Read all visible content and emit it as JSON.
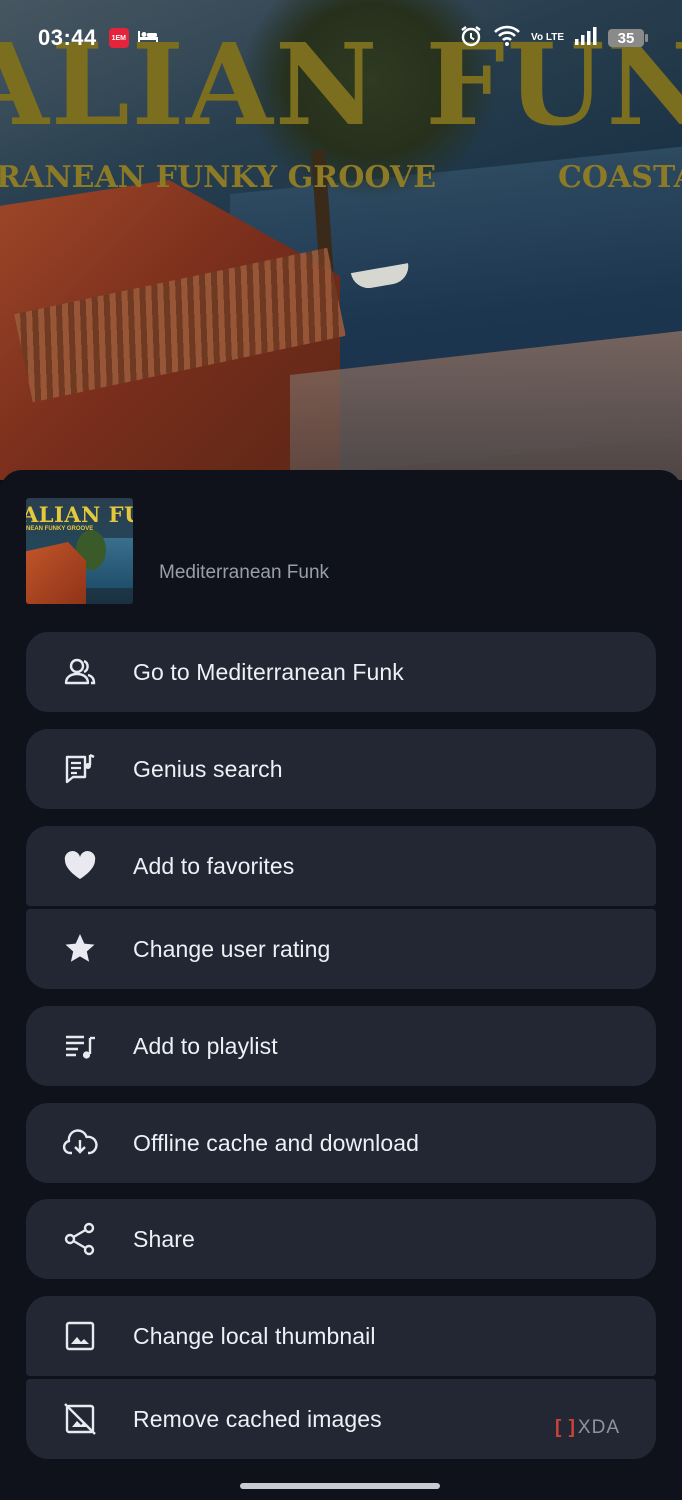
{
  "status_bar": {
    "time": "03:44",
    "notification_badge": "1EM",
    "volte": "Vo LTE",
    "battery": "35"
  },
  "background_art": {
    "title_left": "ALIAN",
    "title_right": "FUN",
    "subtitle_left": "RANEAN FUNKY GROOVE",
    "subtitle_right": "COASTA"
  },
  "thumbnail": {
    "title": "ALIAN FU",
    "subtitle": "NEAN FUNKY GROOVE"
  },
  "track": {
    "artist": "Mediterranean Funk"
  },
  "menu": {
    "items": [
      {
        "label": "Go to Mediterranean Funk",
        "icon": "artist-icon"
      },
      {
        "label": "Genius search",
        "icon": "lyrics-icon"
      },
      {
        "label": "Add to favorites",
        "icon": "heart-icon"
      },
      {
        "label": "Change user rating",
        "icon": "star-icon"
      },
      {
        "label": "Add to playlist",
        "icon": "playlist-add-icon"
      },
      {
        "label": "Offline cache and download",
        "icon": "cloud-download-icon"
      },
      {
        "label": "Share",
        "icon": "share-icon"
      },
      {
        "label": "Change local thumbnail",
        "icon": "image-icon"
      },
      {
        "label": "Remove cached images",
        "icon": "hide-image-icon"
      }
    ]
  },
  "watermark": {
    "text": "XDA"
  },
  "colors": {
    "sheet_background": "#0f121a",
    "menu_item_background": "#232734",
    "menu_text": "#eef0f5",
    "artist_text": "#9a9ea8"
  }
}
